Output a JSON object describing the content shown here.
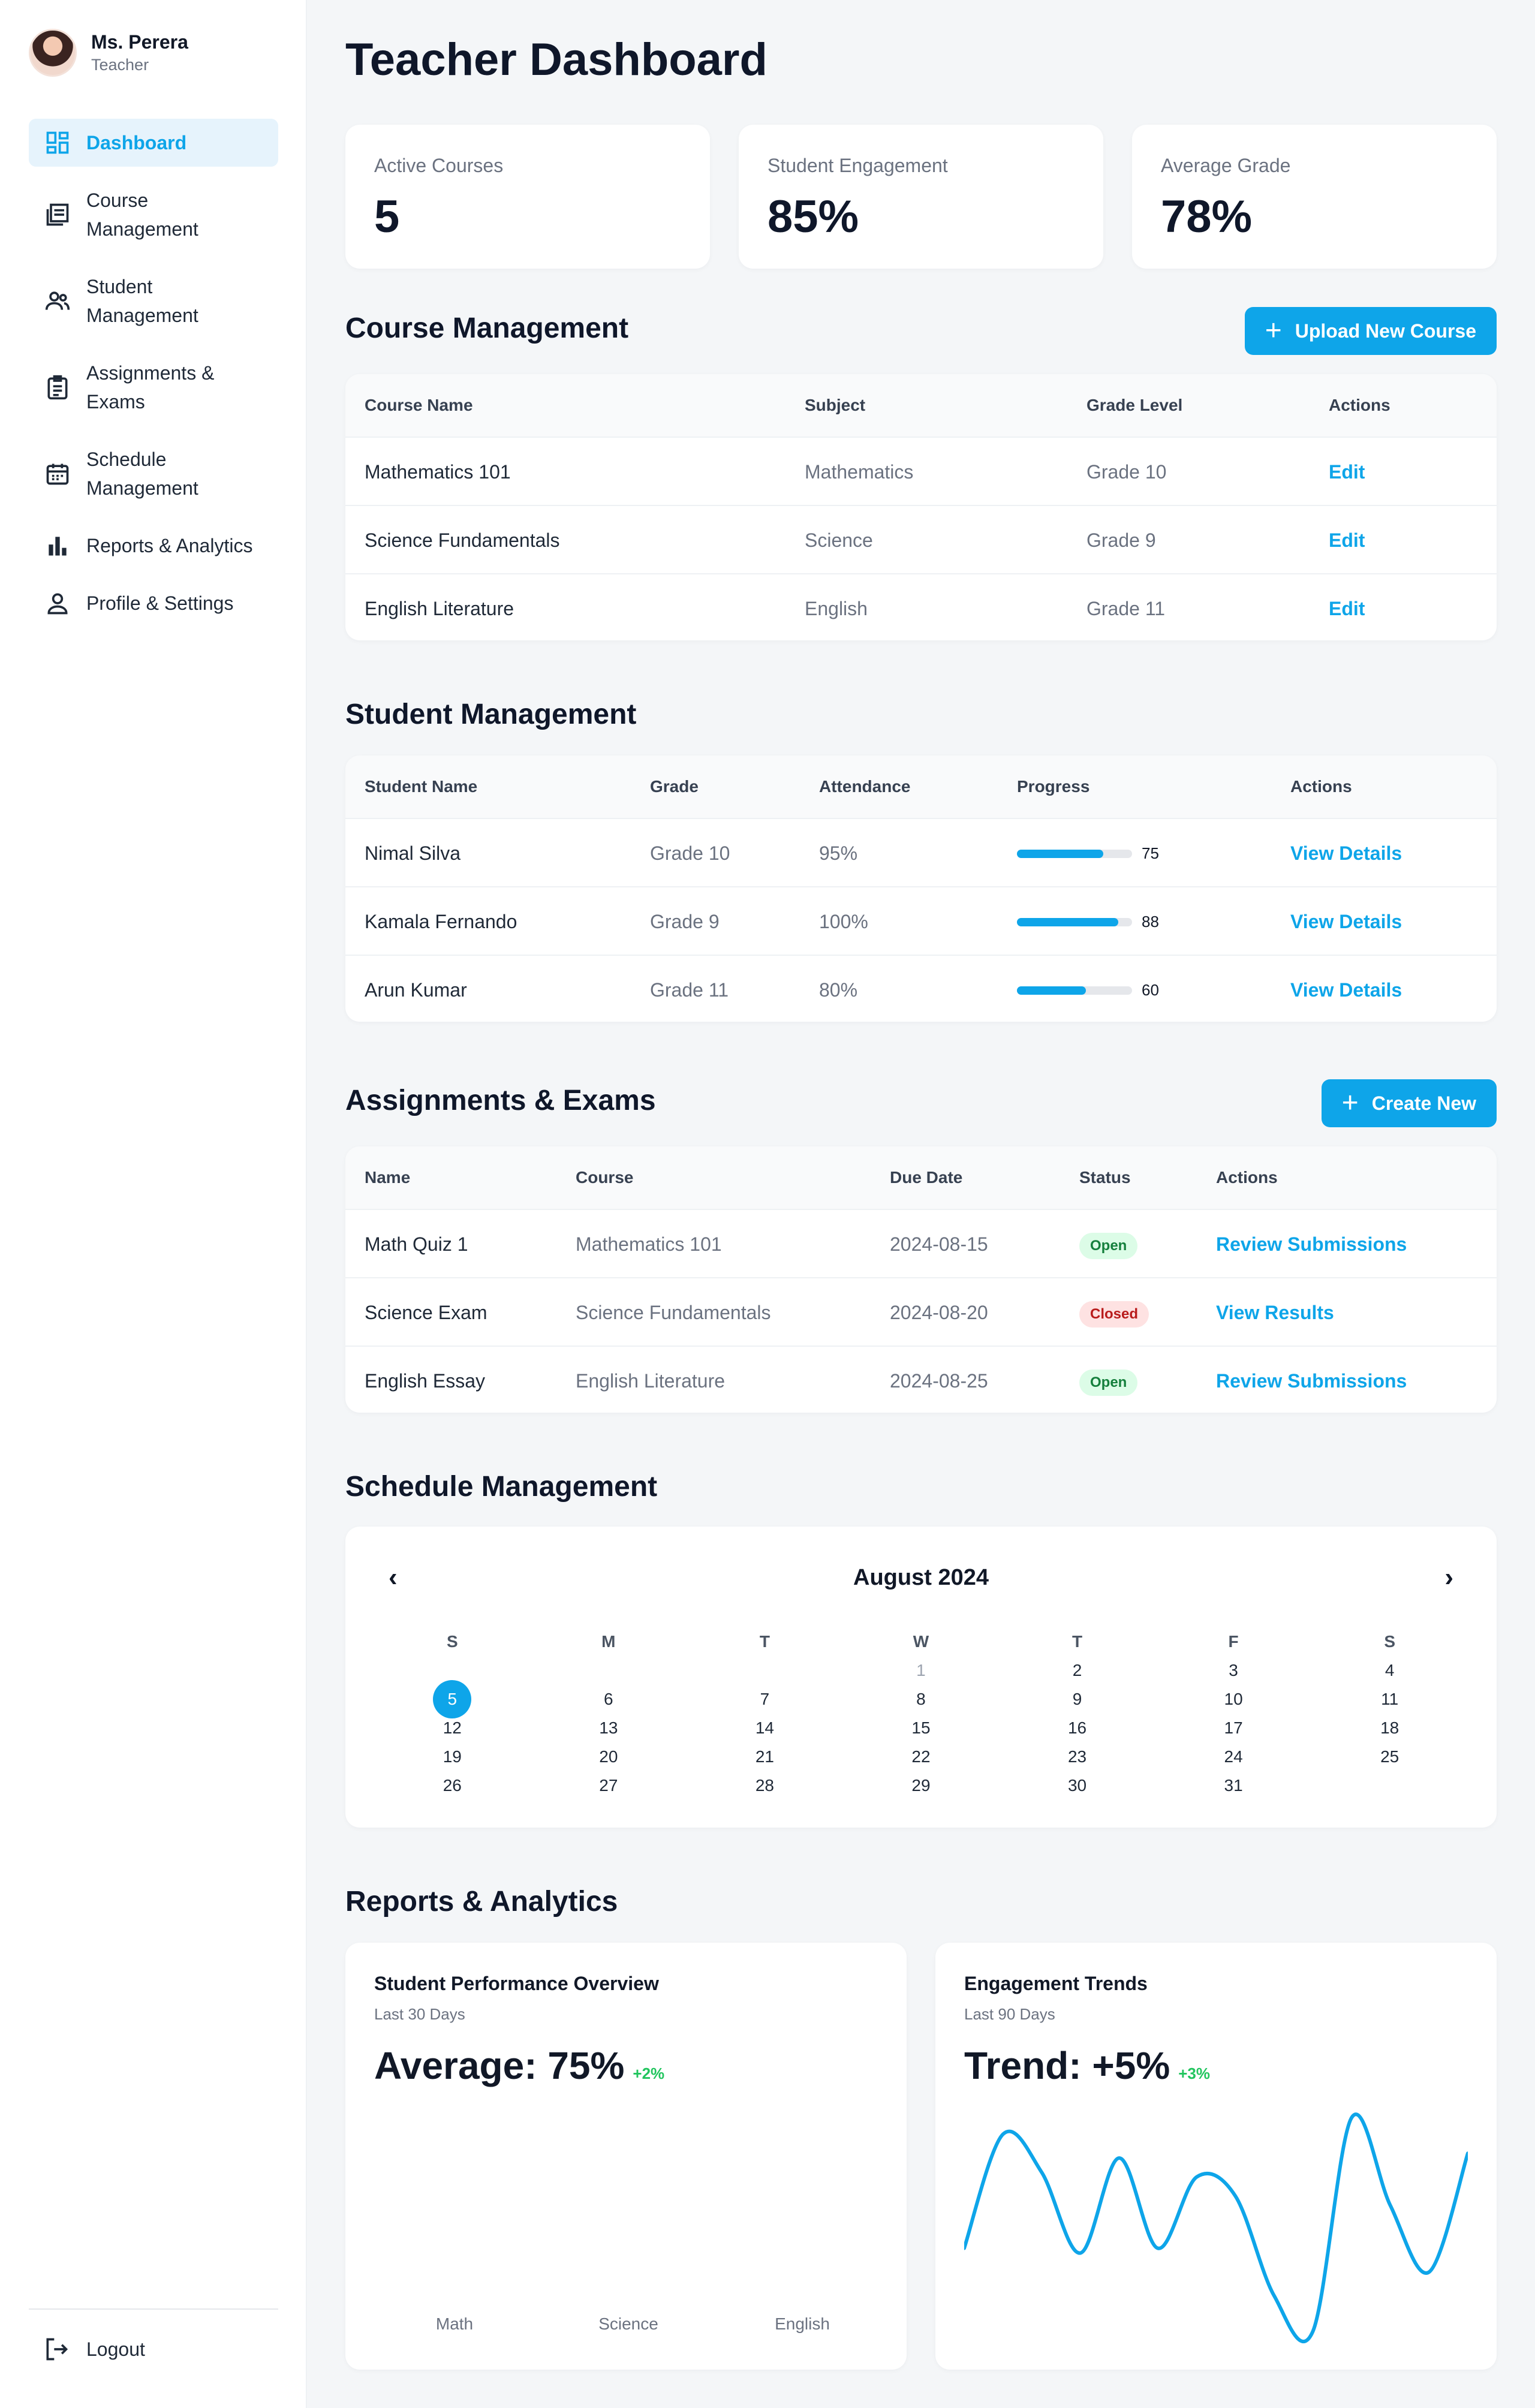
{
  "user": {
    "name": "Ms. Perera",
    "role": "Teacher"
  },
  "nav": {
    "items": [
      {
        "label": "Dashboard",
        "icon": "dashboard-icon",
        "active": true
      },
      {
        "label": "Course Management",
        "icon": "course-icon"
      },
      {
        "label": "Student Management",
        "icon": "students-icon"
      },
      {
        "label": "Assignments & Exams",
        "icon": "assignment-icon"
      },
      {
        "label": "Schedule Management",
        "icon": "calendar-icon"
      },
      {
        "label": "Reports & Analytics",
        "icon": "bar-chart-icon"
      },
      {
        "label": "Profile & Settings",
        "icon": "person-icon"
      }
    ],
    "logout": "Logout"
  },
  "page": {
    "title": "Teacher Dashboard"
  },
  "stats": [
    {
      "label": "Active Courses",
      "value": "5"
    },
    {
      "label": "Student Engagement",
      "value": "85%"
    },
    {
      "label": "Average Grade",
      "value": "78%"
    }
  ],
  "courses": {
    "title": "Course Management",
    "button": "Upload New Course",
    "headers": [
      "Course Name",
      "Subject",
      "Grade Level",
      "Actions"
    ],
    "rows": [
      {
        "name": "Mathematics 101",
        "subject": "Mathematics",
        "grade": "Grade 10",
        "action": "Edit"
      },
      {
        "name": "Science Fundamentals",
        "subject": "Science",
        "grade": "Grade 9",
        "action": "Edit"
      },
      {
        "name": "English Literature",
        "subject": "English",
        "grade": "Grade 11",
        "action": "Edit"
      }
    ]
  },
  "students": {
    "title": "Student Management",
    "headers": [
      "Student Name",
      "Grade",
      "Attendance",
      "Progress",
      "Actions"
    ],
    "rows": [
      {
        "name": "Nimal Silva",
        "grade": "Grade 10",
        "attendance": "95%",
        "progress": 75,
        "progress_label": "75",
        "action": "View Details"
      },
      {
        "name": "Kamala Fernando",
        "grade": "Grade 9",
        "attendance": "100%",
        "progress": 88,
        "progress_label": "88",
        "action": "View Details"
      },
      {
        "name": "Arun Kumar",
        "grade": "Grade 11",
        "attendance": "80%",
        "progress": 60,
        "progress_label": "60",
        "action": "View Details"
      }
    ]
  },
  "assignments": {
    "title": "Assignments & Exams",
    "button": "Create New",
    "headers": [
      "Name",
      "Course",
      "Due Date",
      "Status",
      "Actions"
    ],
    "rows": [
      {
        "name": "Math Quiz 1",
        "course": "Mathematics 101",
        "due": "2024-08-15",
        "status": "Open",
        "action": "Review Submissions"
      },
      {
        "name": "Science Exam",
        "course": "Science Fundamentals",
        "due": "2024-08-20",
        "status": "Closed",
        "action": "View Results"
      },
      {
        "name": "English Essay",
        "course": "English Literature",
        "due": "2024-08-25",
        "status": "Open",
        "action": "Review Submissions"
      }
    ]
  },
  "schedule": {
    "title": "Schedule Management",
    "month": "August 2024",
    "weekdays": [
      "S",
      "M",
      "T",
      "W",
      "T",
      "F",
      "S"
    ],
    "weeks": [
      [
        "",
        "",
        "",
        "1",
        "2",
        "3",
        "4"
      ],
      [
        "5",
        "6",
        "7",
        "8",
        "9",
        "10",
        "11"
      ],
      [
        "12",
        "13",
        "14",
        "15",
        "16",
        "17",
        "18"
      ],
      [
        "19",
        "20",
        "21",
        "22",
        "23",
        "24",
        "25"
      ],
      [
        "26",
        "27",
        "28",
        "29",
        "30",
        "31",
        ""
      ]
    ],
    "today": "5",
    "muted_day": "1"
  },
  "reports": {
    "title": "Reports & Analytics",
    "performance": {
      "title": "Student Performance Overview",
      "subtitle": "Last 30 Days",
      "value": "Average: 75%",
      "delta": "+2%",
      "categories": [
        "Math",
        "Science",
        "English"
      ]
    },
    "engagement": {
      "title": "Engagement Trends",
      "subtitle": "Last 90 Days",
      "value": "Trend: +5%",
      "delta": "+3%"
    }
  },
  "chart_data": [
    {
      "type": "bar",
      "categories": [
        "Math",
        "Science",
        "English"
      ],
      "values": [],
      "title": "Student Performance Overview"
    },
    {
      "type": "line",
      "values": [
        40,
        88,
        72,
        38,
        78,
        40,
        70,
        62,
        20,
        5,
        95,
        58,
        30,
        80
      ],
      "title": "Engagement Trends"
    }
  ],
  "colors": {
    "accent": "#0ea5e9",
    "open": "#15803d",
    "closed": "#b91c1c"
  }
}
